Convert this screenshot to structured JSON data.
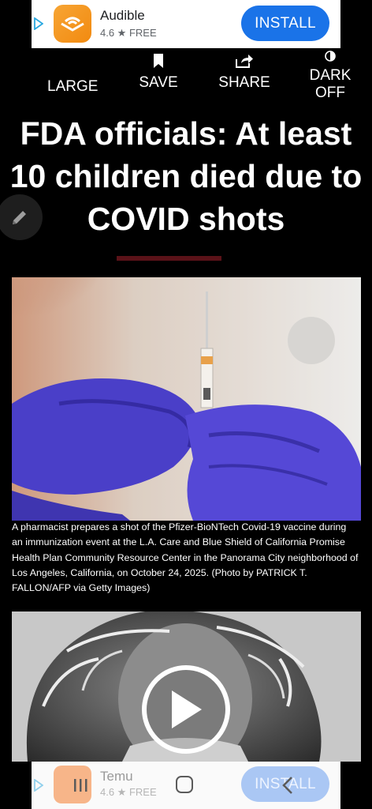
{
  "ad_top": {
    "app_name": "Audible",
    "rating": "4.6 ★  FREE",
    "install_label": "INSTALL"
  },
  "toolbar": {
    "large_label": "LARGE",
    "save_label": "SAVE",
    "share_label": "SHARE",
    "dark_label": "DARK OFF"
  },
  "article": {
    "headline": "FDA officials: At least 10 children died due to COVID shots",
    "caption": "A pharmacist prepares a shot of the Pfizer-BioNTech Covid-19 vaccine during an immunization event at the L.A. Care and Blue Shield of California Promise Health Plan Community Resource Center in the Panorama City neighborhood of Los Angeles, California, on October 24, 2025. (Photo by PATRICK T. FALLON/AFP via Getty Images)"
  },
  "ad_bottom": {
    "app_name": "Temu",
    "rating": "4.6 ★  FREE",
    "install_label": "INSTALL"
  },
  "colors": {
    "accent": "#1a73e8",
    "divider": "#5a1218",
    "background": "#000000"
  }
}
